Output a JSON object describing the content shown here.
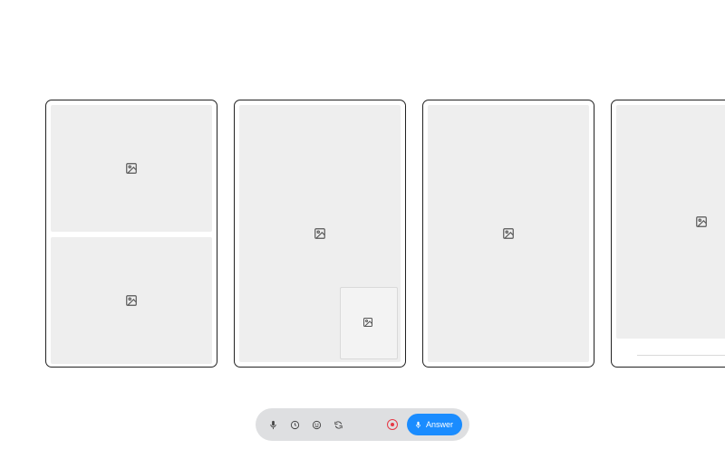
{
  "toolbar": {
    "answer_label": "Answer"
  },
  "cards": [
    {
      "layout": "split-2",
      "placeholders": [
        "image",
        "image"
      ]
    },
    {
      "layout": "full-with-inset",
      "placeholders": [
        "image",
        "image"
      ]
    },
    {
      "layout": "full",
      "placeholders": [
        "image"
      ]
    },
    {
      "layout": "full-with-divider",
      "placeholders": [
        "image"
      ]
    }
  ],
  "icons": {
    "mic": "mic-icon",
    "clock": "clock-icon",
    "smile": "smile-icon",
    "refresh": "refresh-icon",
    "record": "record-icon",
    "answer_mic": "mic-icon"
  }
}
